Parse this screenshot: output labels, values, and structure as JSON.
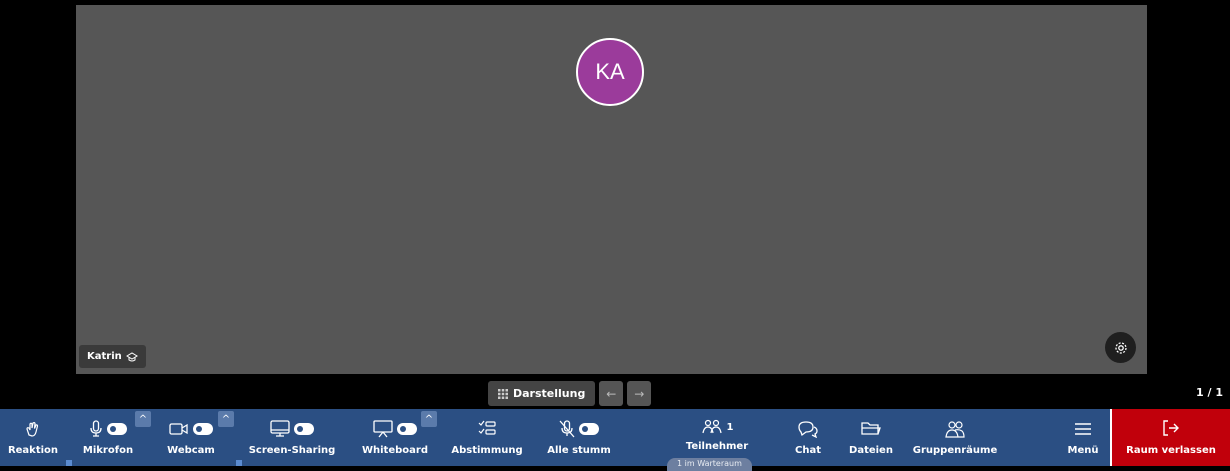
{
  "participant": {
    "initials": "KA",
    "name": "Katrin",
    "avatar_color": "#9b3b9b"
  },
  "layout": {
    "label": "Darstellung",
    "page": "1 / 1"
  },
  "toolbar": {
    "reaction": "Reaktion",
    "mic": "Mikrofon",
    "webcam": "Webcam",
    "screen": "Screen-Sharing",
    "whiteboard": "Whiteboard",
    "poll": "Abstimmung",
    "mute_all": "Alle stumm",
    "participants": "Teilnehmer",
    "participants_count": "1",
    "waiting_room": "1 im Warteraum",
    "chat": "Chat",
    "files": "Dateien",
    "breakout": "Gruppenräume",
    "menu": "Menü",
    "leave": "Raum verlassen"
  },
  "colors": {
    "toolbar_bg": "#2b4f83",
    "leave_bg": "#c1000b",
    "stage_bg": "#565656"
  }
}
